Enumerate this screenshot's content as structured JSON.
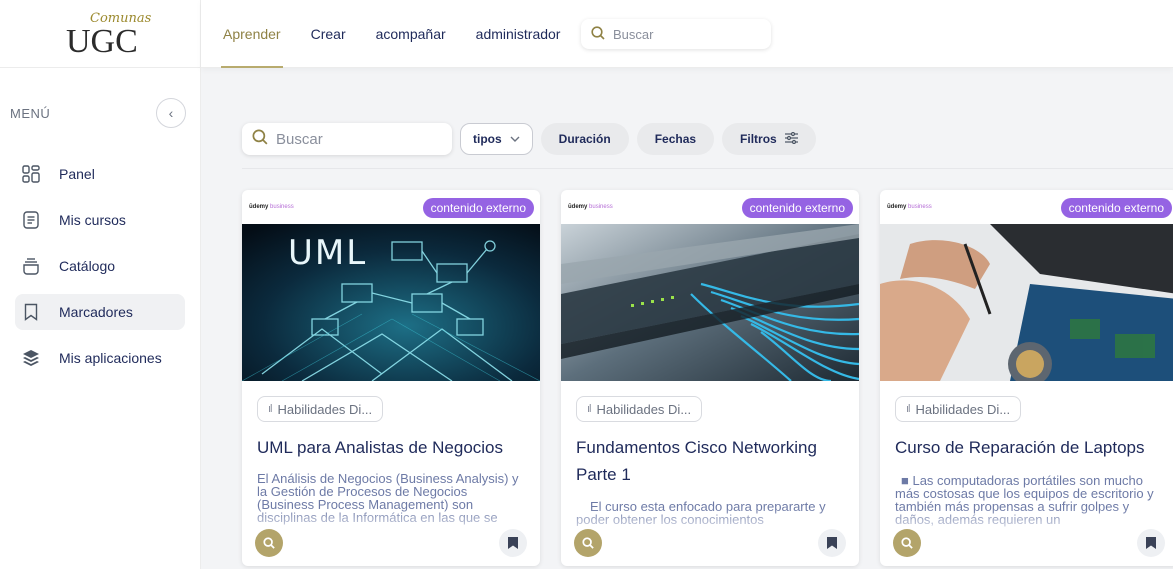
{
  "logo": {
    "text": "UGC",
    "script": "Comunas"
  },
  "sidebar": {
    "menu_label": "MENÚ",
    "collapse_icon": "chevron-left-icon",
    "items": [
      {
        "label": "Panel",
        "icon": "dashboard-grid-icon"
      },
      {
        "label": "Mis cursos",
        "icon": "document-icon"
      },
      {
        "label": "Catálogo",
        "icon": "catalog-tray-icon"
      },
      {
        "label": "Marcadores",
        "icon": "bookmark-icon",
        "active": true
      },
      {
        "label": "Mis aplicaciones",
        "icon": "layers-icon"
      }
    ]
  },
  "topbar": {
    "tabs": [
      {
        "label": "Aprender",
        "active": true
      },
      {
        "label": "Crear"
      },
      {
        "label": "acompañar"
      },
      {
        "label": "administrador"
      }
    ],
    "search_placeholder": "Buscar"
  },
  "filters": {
    "search_placeholder": "Buscar",
    "type_label": "tipos",
    "duration_label": "Duración",
    "dates_label": "Fechas",
    "filters_label": "Filtros"
  },
  "colors": {
    "accent": "#b3a46a",
    "badge": "#9563e3",
    "navy": "#1f2a5a"
  },
  "cards": [
    {
      "brand": "ūdemy",
      "brand_suffix": "business",
      "badge": "contenido externo",
      "image_text": "UML",
      "chip": "Habilidades Di...",
      "title": "UML para Analistas de Negocios",
      "description": "El Análisis de Negocios (Business Analysis) y la Gestión de Procesos de Negocios (Business Process Management) son disciplinas de la Informática en las que se"
    },
    {
      "brand": "ūdemy",
      "brand_suffix": "business",
      "badge": "contenido externo",
      "chip": "Habilidades Di...",
      "title": "Fundamentos Cisco Networking Parte 1",
      "description": "El curso esta enfocado para prepararte y poder obtener los conocimientos"
    },
    {
      "brand": "ūdemy",
      "brand_suffix": "business",
      "badge": "contenido externo",
      "chip": "Habilidades Di...",
      "title": "Curso de Reparación de Laptops",
      "description": "■ Las computadoras portátiles son mucho más costosas que los equipos de escritorio y también más propensas a sufrir golpes y daños, además requieren un"
    }
  ]
}
